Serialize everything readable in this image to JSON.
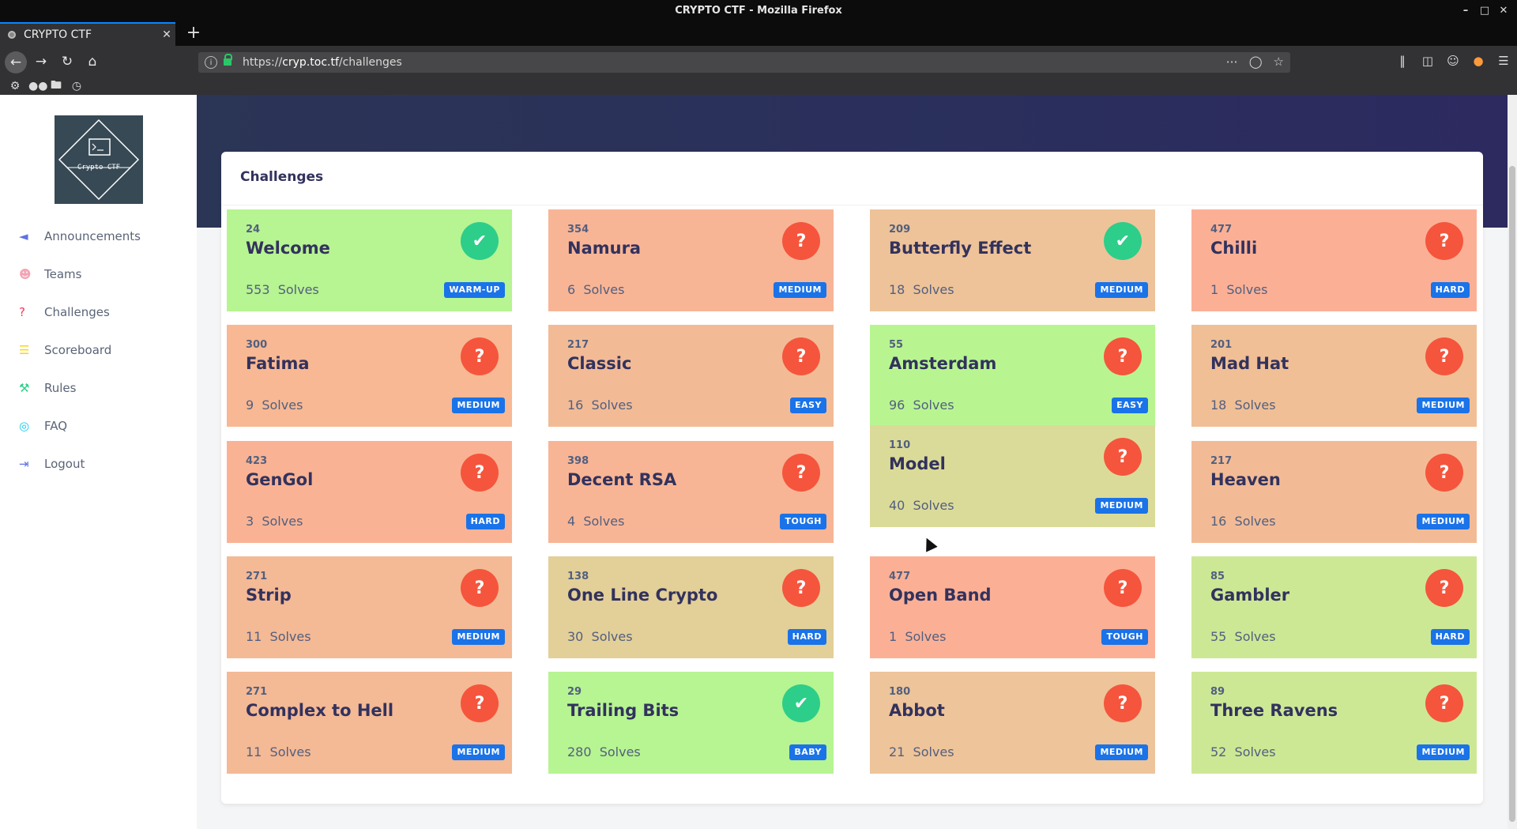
{
  "window": {
    "title": "CRYPTO CTF - Mozilla Firefox",
    "tab_title": "CRYPTO CTF",
    "url_prefix": "https://",
    "url_host": "cryp.toc.tf",
    "url_path": "/challenges"
  },
  "logo": {
    "text": "Crypto CTF",
    "prompt": ">_"
  },
  "sidebar": {
    "items": [
      {
        "label": "Announcements",
        "icon": "megaphone-icon",
        "color": "#5e72e4"
      },
      {
        "label": "Teams",
        "icon": "users-icon",
        "color": "#f3a4b5"
      },
      {
        "label": "Challenges",
        "icon": "question-icon",
        "color": "#f5365c"
      },
      {
        "label": "Scoreboard",
        "icon": "list-icon",
        "color": "#ffd600"
      },
      {
        "label": "Rules",
        "icon": "gavel-icon",
        "color": "#2dce89"
      },
      {
        "label": "FAQ",
        "icon": "compass-icon",
        "color": "#11cdef"
      },
      {
        "label": "Logout",
        "icon": "logout-icon",
        "color": "#5e72e4"
      }
    ]
  },
  "panel": {
    "title": "Challenges",
    "solves_word": "Solves"
  },
  "challenges": [
    {
      "points": "24",
      "name": "Welcome",
      "solves": "553",
      "level": "WARM-UP",
      "solved": true,
      "color": "#b7f492"
    },
    {
      "points": "354",
      "name": "Namura",
      "solves": "6",
      "level": "MEDIUM",
      "solved": false,
      "color": "#f8b596"
    },
    {
      "points": "209",
      "name": "Butterfly Effect",
      "solves": "18",
      "level": "MEDIUM",
      "solved": true,
      "color": "#eec399"
    },
    {
      "points": "477",
      "name": "Chilli",
      "solves": "1",
      "level": "HARD",
      "solved": false,
      "color": "#fbb096"
    },
    {
      "points": "300",
      "name": "Fatima",
      "solves": "9",
      "level": "MEDIUM",
      "solved": false,
      "color": "#f7b893"
    },
    {
      "points": "217",
      "name": "Classic",
      "solves": "16",
      "level": "EASY",
      "solved": false,
      "color": "#f2bb96"
    },
    {
      "points": "55",
      "name": "Amsterdam",
      "solves": "96",
      "level": "EASY",
      "solved": false,
      "color": "#b8f591"
    },
    {
      "points": "201",
      "name": "Mad Hat",
      "solves": "18",
      "level": "MEDIUM",
      "solved": false,
      "color": "#f0bf96"
    },
    {
      "points": "423",
      "name": "GenGol",
      "solves": "3",
      "level": "HARD",
      "solved": false,
      "color": "#f9b394"
    },
    {
      "points": "398",
      "name": "Decent RSA",
      "solves": "4",
      "level": "TOUGH",
      "solved": false,
      "color": "#f8b595"
    },
    {
      "points": "110",
      "name": "Model",
      "solves": "40",
      "level": "MEDIUM",
      "solved": false,
      "color": "#dbdb99"
    },
    {
      "points": "217",
      "name": "Heaven",
      "solves": "16",
      "level": "MEDIUM",
      "solved": false,
      "color": "#f2bb96"
    },
    {
      "points": "271",
      "name": "Strip",
      "solves": "11",
      "level": "MEDIUM",
      "solved": false,
      "color": "#f4b995"
    },
    {
      "points": "138",
      "name": "One Line Crypto",
      "solves": "30",
      "level": "HARD",
      "solved": false,
      "color": "#e3cf98"
    },
    {
      "points": "477",
      "name": "Open Band",
      "solves": "1",
      "level": "TOUGH",
      "solved": false,
      "color": "#fbb096"
    },
    {
      "points": "85",
      "name": "Gambler",
      "solves": "55",
      "level": "HARD",
      "solved": false,
      "color": "#cce895"
    },
    {
      "points": "271",
      "name": "Complex to Hell",
      "solves": "11",
      "level": "MEDIUM",
      "solved": false,
      "color": "#f4b995"
    },
    {
      "points": "29",
      "name": "Trailing Bits",
      "solves": "280",
      "level": "BABY",
      "solved": true,
      "color": "#b7f492"
    },
    {
      "points": "180",
      "name": "Abbot",
      "solves": "21",
      "level": "MEDIUM",
      "solved": false,
      "color": "#eec49a"
    },
    {
      "points": "89",
      "name": "Three Ravens",
      "solves": "52",
      "level": "MEDIUM",
      "solved": false,
      "color": "#cde895"
    }
  ]
}
